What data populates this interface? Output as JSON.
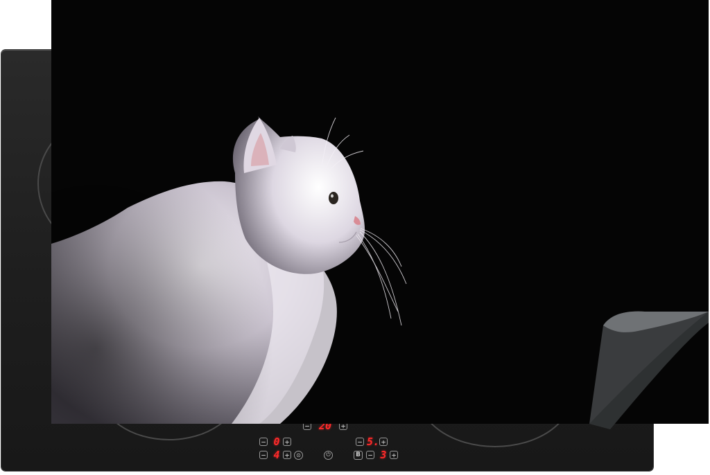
{
  "scene": {
    "subject": "cat-profile",
    "product": "induction-hob-cover-mat"
  },
  "colors": {
    "background": "#050505",
    "hob_body": "#1e1e1e",
    "display_red": "#ff2a2a",
    "cat_fur": "#e4dee8"
  },
  "controls": {
    "timer": {
      "value": "20",
      "minus": "−",
      "plus": "+"
    },
    "zone_front_left": {
      "value": "0",
      "minus": "−",
      "plus": "+"
    },
    "zone_back_right": {
      "value": "5.",
      "minus": "−",
      "plus": "+"
    },
    "zone_mid_left": {
      "value": "4",
      "minus": "−",
      "plus": "+"
    },
    "zone_front_right": {
      "value": "3",
      "minus": "−",
      "plus": "+"
    },
    "lock_glyph": "⊙",
    "power_glyph": "⏻",
    "boost_label": "B"
  }
}
